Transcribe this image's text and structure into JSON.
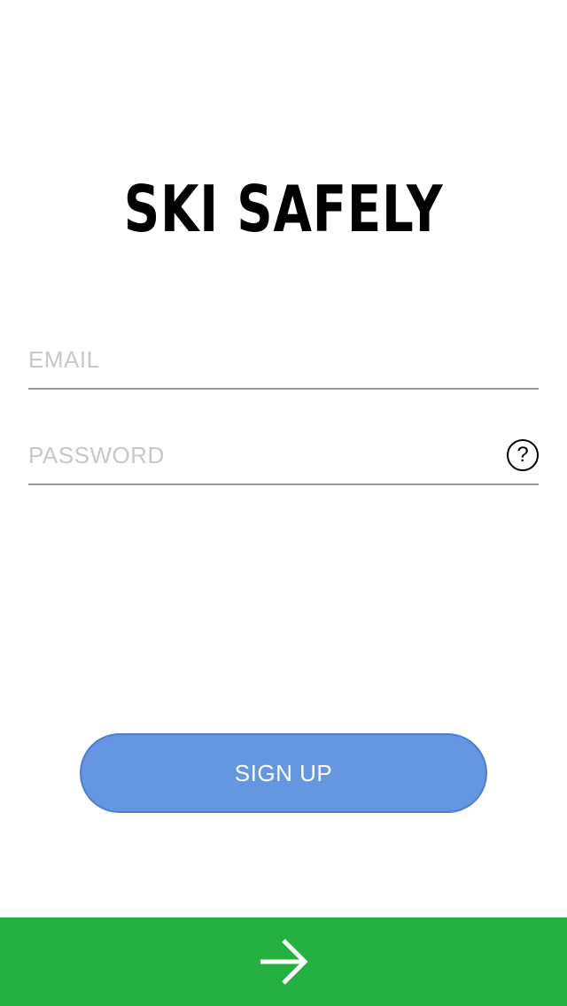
{
  "app": {
    "logo_text": "SKI SAFELY"
  },
  "form": {
    "email": {
      "placeholder": "EMAIL",
      "value": ""
    },
    "password": {
      "placeholder": "PASSWORD",
      "value": "",
      "help_label": "?",
      "help_icon": "question-circle-icon"
    }
  },
  "actions": {
    "signup_label": "SIGN UP",
    "next_icon": "arrow-right-icon"
  },
  "colors": {
    "signup_bg": "#6596e1",
    "next_bar_bg": "#25b042",
    "underline": "#9b9b9b"
  }
}
